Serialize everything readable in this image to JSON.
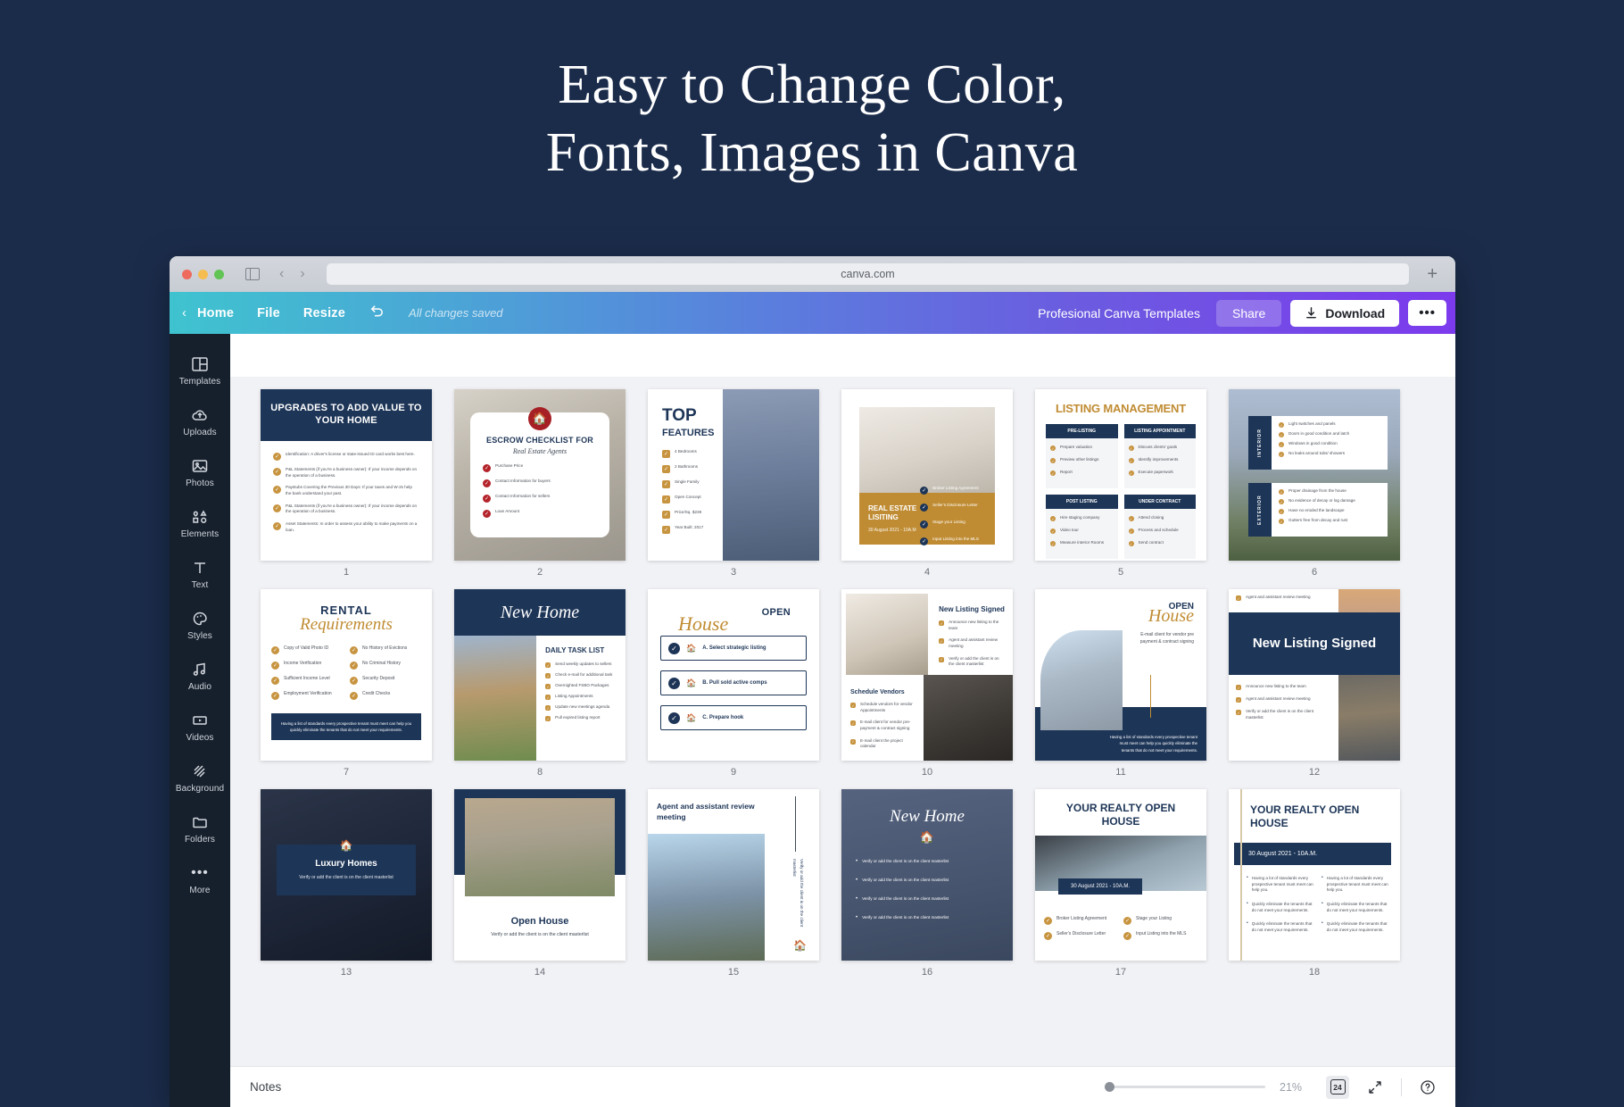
{
  "headline": {
    "line1": "Easy to Change Color,",
    "line2": "Fonts, Images in Canva"
  },
  "browser": {
    "url": "canva.com",
    "new_tab_label": "+",
    "back_arrow": "‹",
    "forward_arrow": "›"
  },
  "toolbar": {
    "back_label": "‹",
    "home_label": "Home",
    "file_label": "File",
    "resize_label": "Resize",
    "undo_icon": "undo-icon",
    "saved_status": "All changes saved",
    "doc_name": "Profesional Canva Templates",
    "share_label": "Share",
    "download_label": "Download",
    "more_label": "•••",
    "accent_start": "#3fc3cf",
    "accent_end": "#7c3aed"
  },
  "sidebar": {
    "items": [
      {
        "label": "Templates",
        "icon": "templates-icon"
      },
      {
        "label": "Uploads",
        "icon": "uploads-icon"
      },
      {
        "label": "Photos",
        "icon": "photos-icon"
      },
      {
        "label": "Elements",
        "icon": "elements-icon"
      },
      {
        "label": "Text",
        "icon": "text-icon"
      },
      {
        "label": "Styles",
        "icon": "styles-icon"
      },
      {
        "label": "Audio",
        "icon": "audio-icon"
      },
      {
        "label": "Videos",
        "icon": "videos-icon"
      },
      {
        "label": "Background",
        "icon": "background-icon"
      },
      {
        "label": "Folders",
        "icon": "folders-icon"
      },
      {
        "label": "More",
        "icon": "more-icon"
      }
    ]
  },
  "bottom": {
    "notes_label": "Notes",
    "zoom_percent": "21%",
    "page_count": "24",
    "expand_icon": "expand-icon",
    "help_icon": "help-icon",
    "duplicate_icon": "duplicate-page-icon",
    "delete_icon": "delete-page-icon"
  },
  "slides": [
    {
      "n": "1",
      "title": "UPGRADES TO ADD VALUE TO YOUR HOME",
      "items": [
        "Identification: A driver's license or state-issued ID card works best here.",
        "P&L Statements (if you're a business owner): If your income depends on the operation of a business.",
        "Paystubs Covering the Previous 30 Days: If your taxes and W-2s help the bank understand your past.",
        "P&L Statements (if you're a business owner): If your income depends on the operation of a business.",
        "Asset Statements: In order to assess your ability to make payments on a loan."
      ]
    },
    {
      "n": "2",
      "title": "ESCROW CHECKLIST FOR",
      "script": "Real Estate Agents",
      "items": [
        "Purchase Price",
        "Contact Information for buyers",
        "Contact Information for sellers",
        "Loan Amount"
      ]
    },
    {
      "n": "3",
      "title": "TOP",
      "subtitle": "FEATURES",
      "items": [
        "4 Bedrooms",
        "2 Bathrooms",
        "Single Family",
        "Open Concept",
        "Price/Sq. $239",
        "Year Built: 2017"
      ]
    },
    {
      "n": "4",
      "title": "REAL ESTATE LISITING",
      "date": "30 August 2021 - 10A.M",
      "items": [
        "Broker Listing Agreement",
        "Seller's Disclosure Letter",
        "Stage your Listing",
        "Input Listing into the MLS"
      ]
    },
    {
      "n": "5",
      "title": "LISTING MANAGEMENT",
      "quadrants": [
        {
          "head": "PRE-LISTING",
          "items": [
            "Prepare valuation",
            "Preview other listings",
            "Report"
          ]
        },
        {
          "head": "LISTING APPOINTMENT",
          "items": [
            "Discuss clients' goals",
            "Identify improvements",
            "Execute paperwork"
          ]
        },
        {
          "head": "POST LISTING",
          "items": [
            "Hire staging company",
            "Video tour",
            "Measure interior Rooms"
          ]
        },
        {
          "head": "UNDER CONTRACT",
          "items": [
            "Attend closing",
            "Process and schedule",
            "Send contract"
          ]
        }
      ]
    },
    {
      "n": "6",
      "groups": [
        {
          "tab": "INTERIOR",
          "items": [
            "Light switches and panels",
            "Doors in good condition and latch",
            "Windows in good condition",
            "No leaks around tubs/ showers"
          ]
        },
        {
          "tab": "EXTERIOR",
          "items": [
            "Proper drainage from the house",
            "No evidence of decay or log damage",
            "Have no eroded the landscape",
            "Gutters free from decay and rust"
          ]
        }
      ]
    },
    {
      "n": "7",
      "title": "RENTAL",
      "script": "Requirements",
      "colA": [
        "Copy of Valid Photo ID",
        "Income Verification",
        "Sufficient Income Level",
        "Employment Verification"
      ],
      "colB": [
        "No History of Evictions",
        "No Criminal History",
        "Security Deposit",
        "Credit Checks"
      ],
      "footer": "Having a list of standards every prospective tenant must meet can help you quickly eliminate the tenants that do not meet your requirements."
    },
    {
      "n": "8",
      "script": "New Home",
      "title": "DAILY TASK LIST",
      "items": [
        "Send weekly updates to sellers",
        "Check e-mail for additional task",
        "Overnighted FSBO Packages",
        "Listing Appointments",
        "Update new meetings agenda",
        "Pull expired listing report"
      ]
    },
    {
      "n": "9",
      "title": "OPEN",
      "script": "House",
      "items": [
        "A. Select strategic listing",
        "B. Pull sold active comps",
        "C. Prepare hook"
      ]
    },
    {
      "n": "10",
      "title": "New Listing Signed",
      "title2": "Schedule Vendors",
      "items": [
        "Announce new listing to the team",
        "Agent and assistant review meeting",
        "Verify or add the client is on the client masterlist"
      ],
      "items2": [
        "Schedule vendors for vendor Appointments",
        "E-mail client for vendor pre-payment & contract signing",
        "E-mail client the project calendar"
      ]
    },
    {
      "n": "11",
      "title": "OPEN",
      "script": "House",
      "note": "E-mail client for vendor pre payment & contract signing",
      "footer": "Having a list of standards every prospective tenant must meet can help you quickly eliminate the tenants that do not meet your requirements."
    },
    {
      "n": "12",
      "title": "New Listing Signed",
      "topItem": "Agent and assistant review meeting",
      "items": [
        "Announce new listing to the team",
        "Agent and assistant review meeting",
        "Verify or add the client is on the client masterlist"
      ]
    },
    {
      "n": "13",
      "title": "Luxury Homes",
      "sub": "Verify or add the client is on the client masterlist"
    },
    {
      "n": "14",
      "title": "Open House",
      "sub": "Verify or add the client is on the client masterlist"
    },
    {
      "n": "15",
      "title": "Agent and assistant review meeting",
      "side": "Verify or add the client is on the client masterlist"
    },
    {
      "n": "16",
      "script": "New Home",
      "items": [
        "Verify or add the client is on the client masterlist",
        "Verify or add the client is on the client masterlist",
        "Verify or add the client is on the client masterlist",
        "Verify or add the client is on the client masterlist"
      ]
    },
    {
      "n": "17",
      "title": "YOUR REALTY OPEN HOUSE",
      "date": "30 August 2021 - 10A.M.",
      "colA": [
        "Broker Listing Agreement",
        "Seller's Disclosure Letter"
      ],
      "colB": [
        "Stage your Listing",
        "Input Listing into the MLS"
      ]
    },
    {
      "n": "18",
      "title": "YOUR REALTY OPEN HOUSE",
      "date": "30 August 2021 - 10A.M.",
      "colA": [
        "Having a lot of standards every prospective tenant must meet can help you.",
        "Quickly eliminate the tenants that do not meet your requirements.",
        "Quickly eliminate the tenants that do not meet your requirements."
      ],
      "colB": [
        "Having a lot of standards every prospective tenant must meet can help you.",
        "Quickly eliminate the tenants that do not meet your requirements.",
        "Quickly eliminate the tenants that do not meet your requirements."
      ]
    }
  ]
}
